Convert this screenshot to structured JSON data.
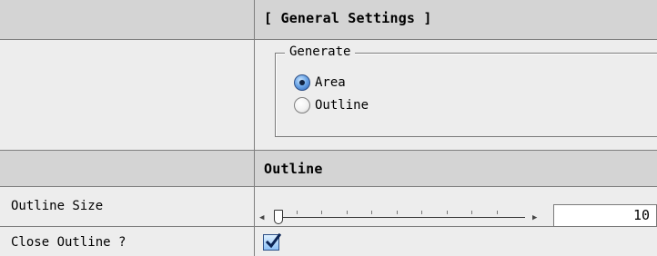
{
  "sections": {
    "general_title": "[ General Settings ]",
    "outline_title": "Outline"
  },
  "generate_group": {
    "legend": "Generate",
    "options": [
      {
        "label": "Area",
        "selected": true
      },
      {
        "label": "Outline",
        "selected": false
      }
    ]
  },
  "outline_size": {
    "label": "Outline Size",
    "value": "10"
  },
  "close_outline": {
    "label": "Close Outline ?",
    "checked": true
  },
  "colors": {
    "header_bg": "#d4d4d4",
    "panel_bg": "#ededed",
    "accent": "#2a62b8"
  }
}
